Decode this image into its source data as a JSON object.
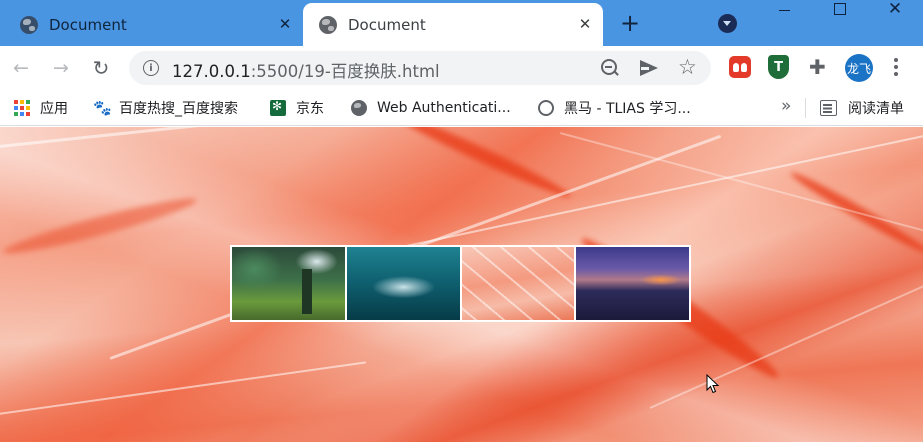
{
  "tabs": [
    {
      "title": "Document",
      "active": false
    },
    {
      "title": "Document",
      "active": true
    }
  ],
  "tab_strip": {
    "new_tab_symbol": "+",
    "close_symbol": "✕"
  },
  "toolbar": {
    "url_host": "127.0.0.1",
    "url_path": ":5500/19-百度换肤.html",
    "info_symbol": "i",
    "star_symbol": "☆",
    "puzzle_symbol": "✚",
    "shield_letter": "T",
    "avatar_text": "龙飞"
  },
  "bookmarks": [
    {
      "label": "应用",
      "icon": "apps-icon"
    },
    {
      "label": "百度热搜_百度搜索",
      "icon": "baidu-icon"
    },
    {
      "label": "京东",
      "icon": "jd-icon"
    },
    {
      "label": "Web Authenticati...",
      "icon": "globe-icon"
    },
    {
      "label": "黑马 - TLIAS 学习...",
      "icon": "cat-icon"
    }
  ],
  "bookmarks_overflow": "»",
  "reading_list": "阅读清单",
  "skin_thumbnails": [
    {
      "name": "forest-waterfall"
    },
    {
      "name": "ocean-wave"
    },
    {
      "name": "flamingo-feather"
    },
    {
      "name": "purple-sunset"
    }
  ],
  "colors": {
    "tab_strip": "#4a95e2",
    "active_tab": "#ffffff",
    "omnibox": "#f1f3f4",
    "avatar": "#1a73c4",
    "page_background": "#f49579"
  }
}
